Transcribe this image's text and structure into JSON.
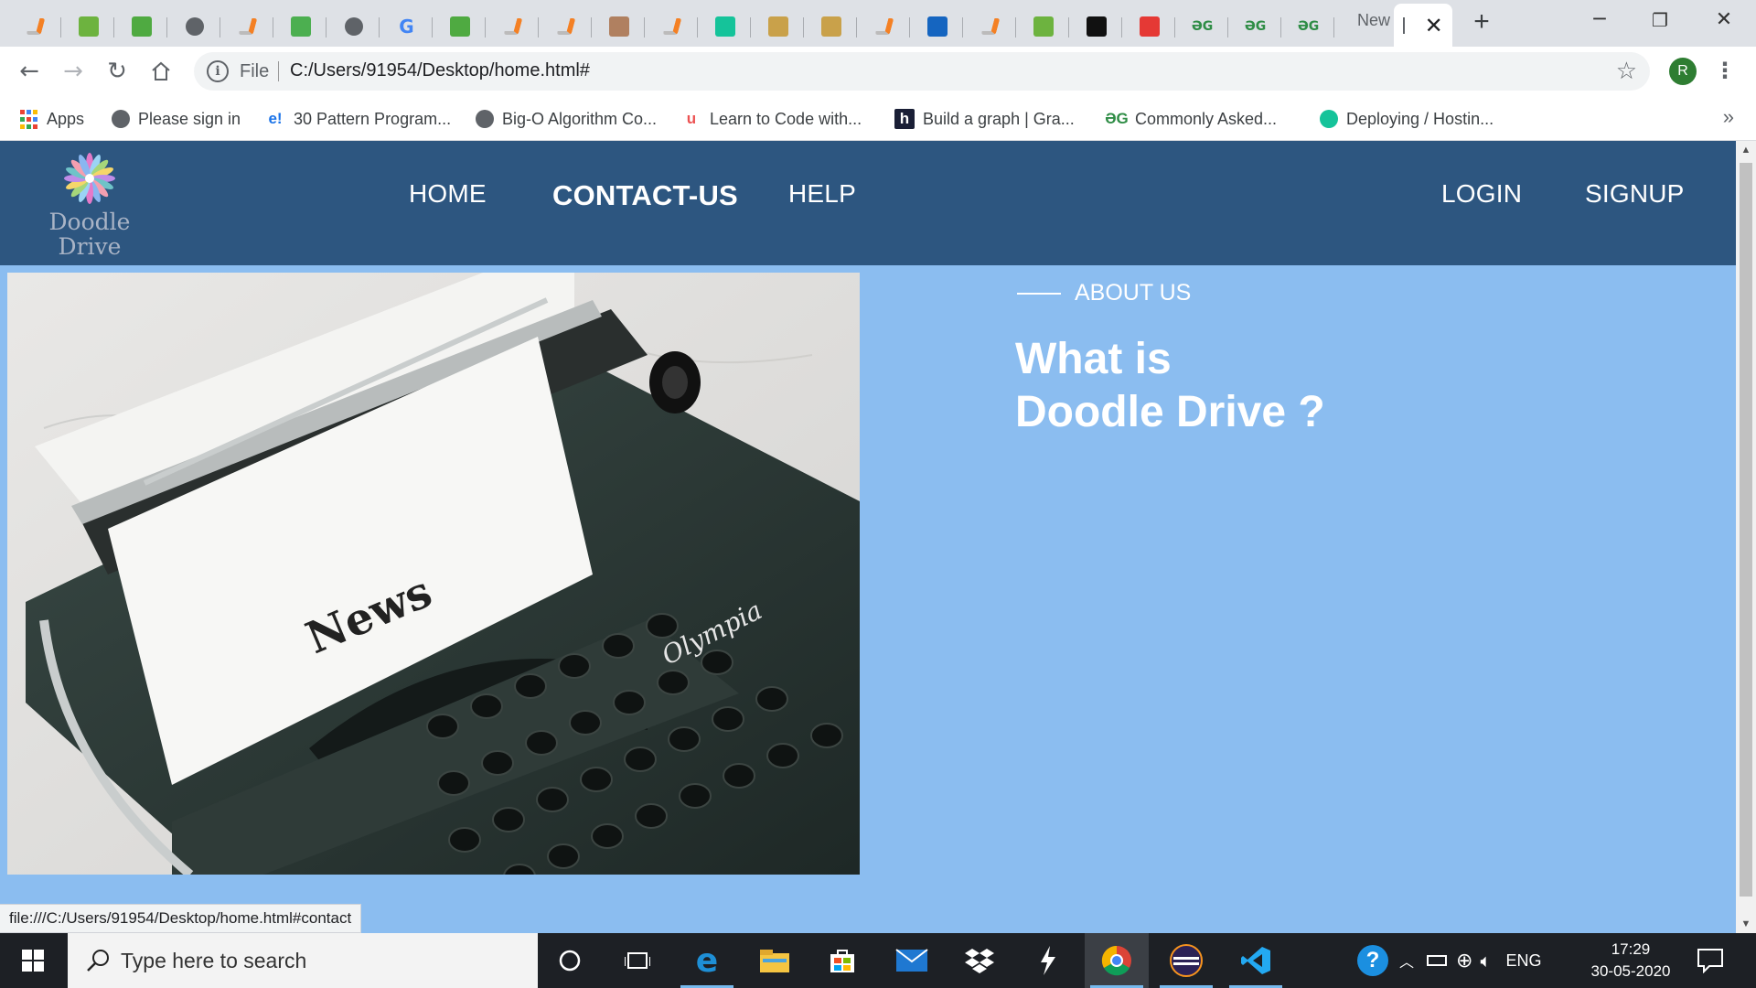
{
  "browser": {
    "tabs": [
      {
        "icon": "stackoverflow-icon",
        "color": "#f48024"
      },
      {
        "icon": "spring-icon",
        "color": "#6db33f"
      },
      {
        "icon": "mongodb-leaf-icon",
        "color": "#4faa41"
      },
      {
        "icon": "globe-icon",
        "color": "#5f6368"
      },
      {
        "icon": "stackoverflow-icon",
        "color": "#f48024"
      },
      {
        "icon": "w3schools-icon",
        "color": "#4caf50"
      },
      {
        "icon": "globe-icon",
        "color": "#5f6368"
      },
      {
        "icon": "google-icon",
        "color": "#4285f4"
      },
      {
        "icon": "mongodb-leaf-icon",
        "color": "#4faa41"
      },
      {
        "icon": "stackoverflow-icon",
        "color": "#f48024"
      },
      {
        "icon": "stackoverflow-icon",
        "color": "#f48024"
      },
      {
        "icon": "avatar-icon",
        "color": "#b08060"
      },
      {
        "icon": "stackoverflow-icon",
        "color": "#f48024"
      },
      {
        "icon": "grammarly-icon",
        "color": "#15c39a"
      },
      {
        "icon": "avatar-icon",
        "color": "#c9a14a"
      },
      {
        "icon": "avatar-icon",
        "color": "#c9a14a"
      },
      {
        "icon": "stackoverflow-icon",
        "color": "#f48024"
      },
      {
        "icon": "document-sign-icon",
        "color": "#1565c0"
      },
      {
        "icon": "stackoverflow-icon",
        "color": "#f48024"
      },
      {
        "icon": "spring-icon",
        "color": "#6db33f"
      },
      {
        "icon": "hackerrank-icon",
        "color": "#111111"
      },
      {
        "icon": "book-icon",
        "color": "#e53935"
      },
      {
        "icon": "geeksforgeeks-icon",
        "color": "#2f8d46",
        "glyph": "ƏG"
      },
      {
        "icon": "geeksforgeeks-icon",
        "color": "#2f8d46",
        "glyph": "ƏG"
      },
      {
        "icon": "geeksforgeeks-icon",
        "color": "#2f8d46",
        "glyph": "ƏG"
      }
    ],
    "new_tab_label": "New",
    "active_tab_icon": "blank-page-icon",
    "omnibox": {
      "scheme_label": "File",
      "url": "C:/Users/91954/Desktop/home.html#"
    },
    "profile_initial": "R",
    "bookmarks": [
      {
        "icon": "apps-grid-icon",
        "label": "Apps"
      },
      {
        "icon": "globe-icon",
        "label": "Please sign in"
      },
      {
        "icon": "edureka-icon",
        "glyph": "e!",
        "label": "30 Pattern Program..."
      },
      {
        "icon": "globe-icon",
        "label": "Big-O Algorithm Co..."
      },
      {
        "icon": "udemy-icon",
        "glyph": "u",
        "label": "Learn to Code with..."
      },
      {
        "icon": "hashnode-icon",
        "glyph": "h",
        "label": "Build a graph | Gra..."
      },
      {
        "icon": "geeksforgeeks-icon",
        "glyph": "ƏG",
        "label": "Commonly Asked..."
      },
      {
        "icon": "grammarly-icon",
        "label": "Deploying / Hostin..."
      }
    ],
    "status_url": "file:///C:/Users/91954/Desktop/home.html#contact"
  },
  "site": {
    "logo": {
      "line1": "Doodle",
      "line2": "Drive"
    },
    "nav": {
      "home": "HOME",
      "contact": "CONTACT-US",
      "help": "HELP",
      "login": "LOGIN",
      "signup": "SIGNUP"
    },
    "about": {
      "label": "ABOUT US",
      "heading_line1": "What is",
      "heading_line2": "Doodle Drive ?"
    },
    "image": {
      "paper_text": "News",
      "brand_text": "Olympia"
    }
  },
  "taskbar": {
    "search_placeholder": "Type here to search",
    "language": "ENG",
    "time": "17:29",
    "date": "30-05-2020"
  },
  "colors": {
    "nav_bg": "#2d5680",
    "page_bg": "#8bbdf0"
  }
}
